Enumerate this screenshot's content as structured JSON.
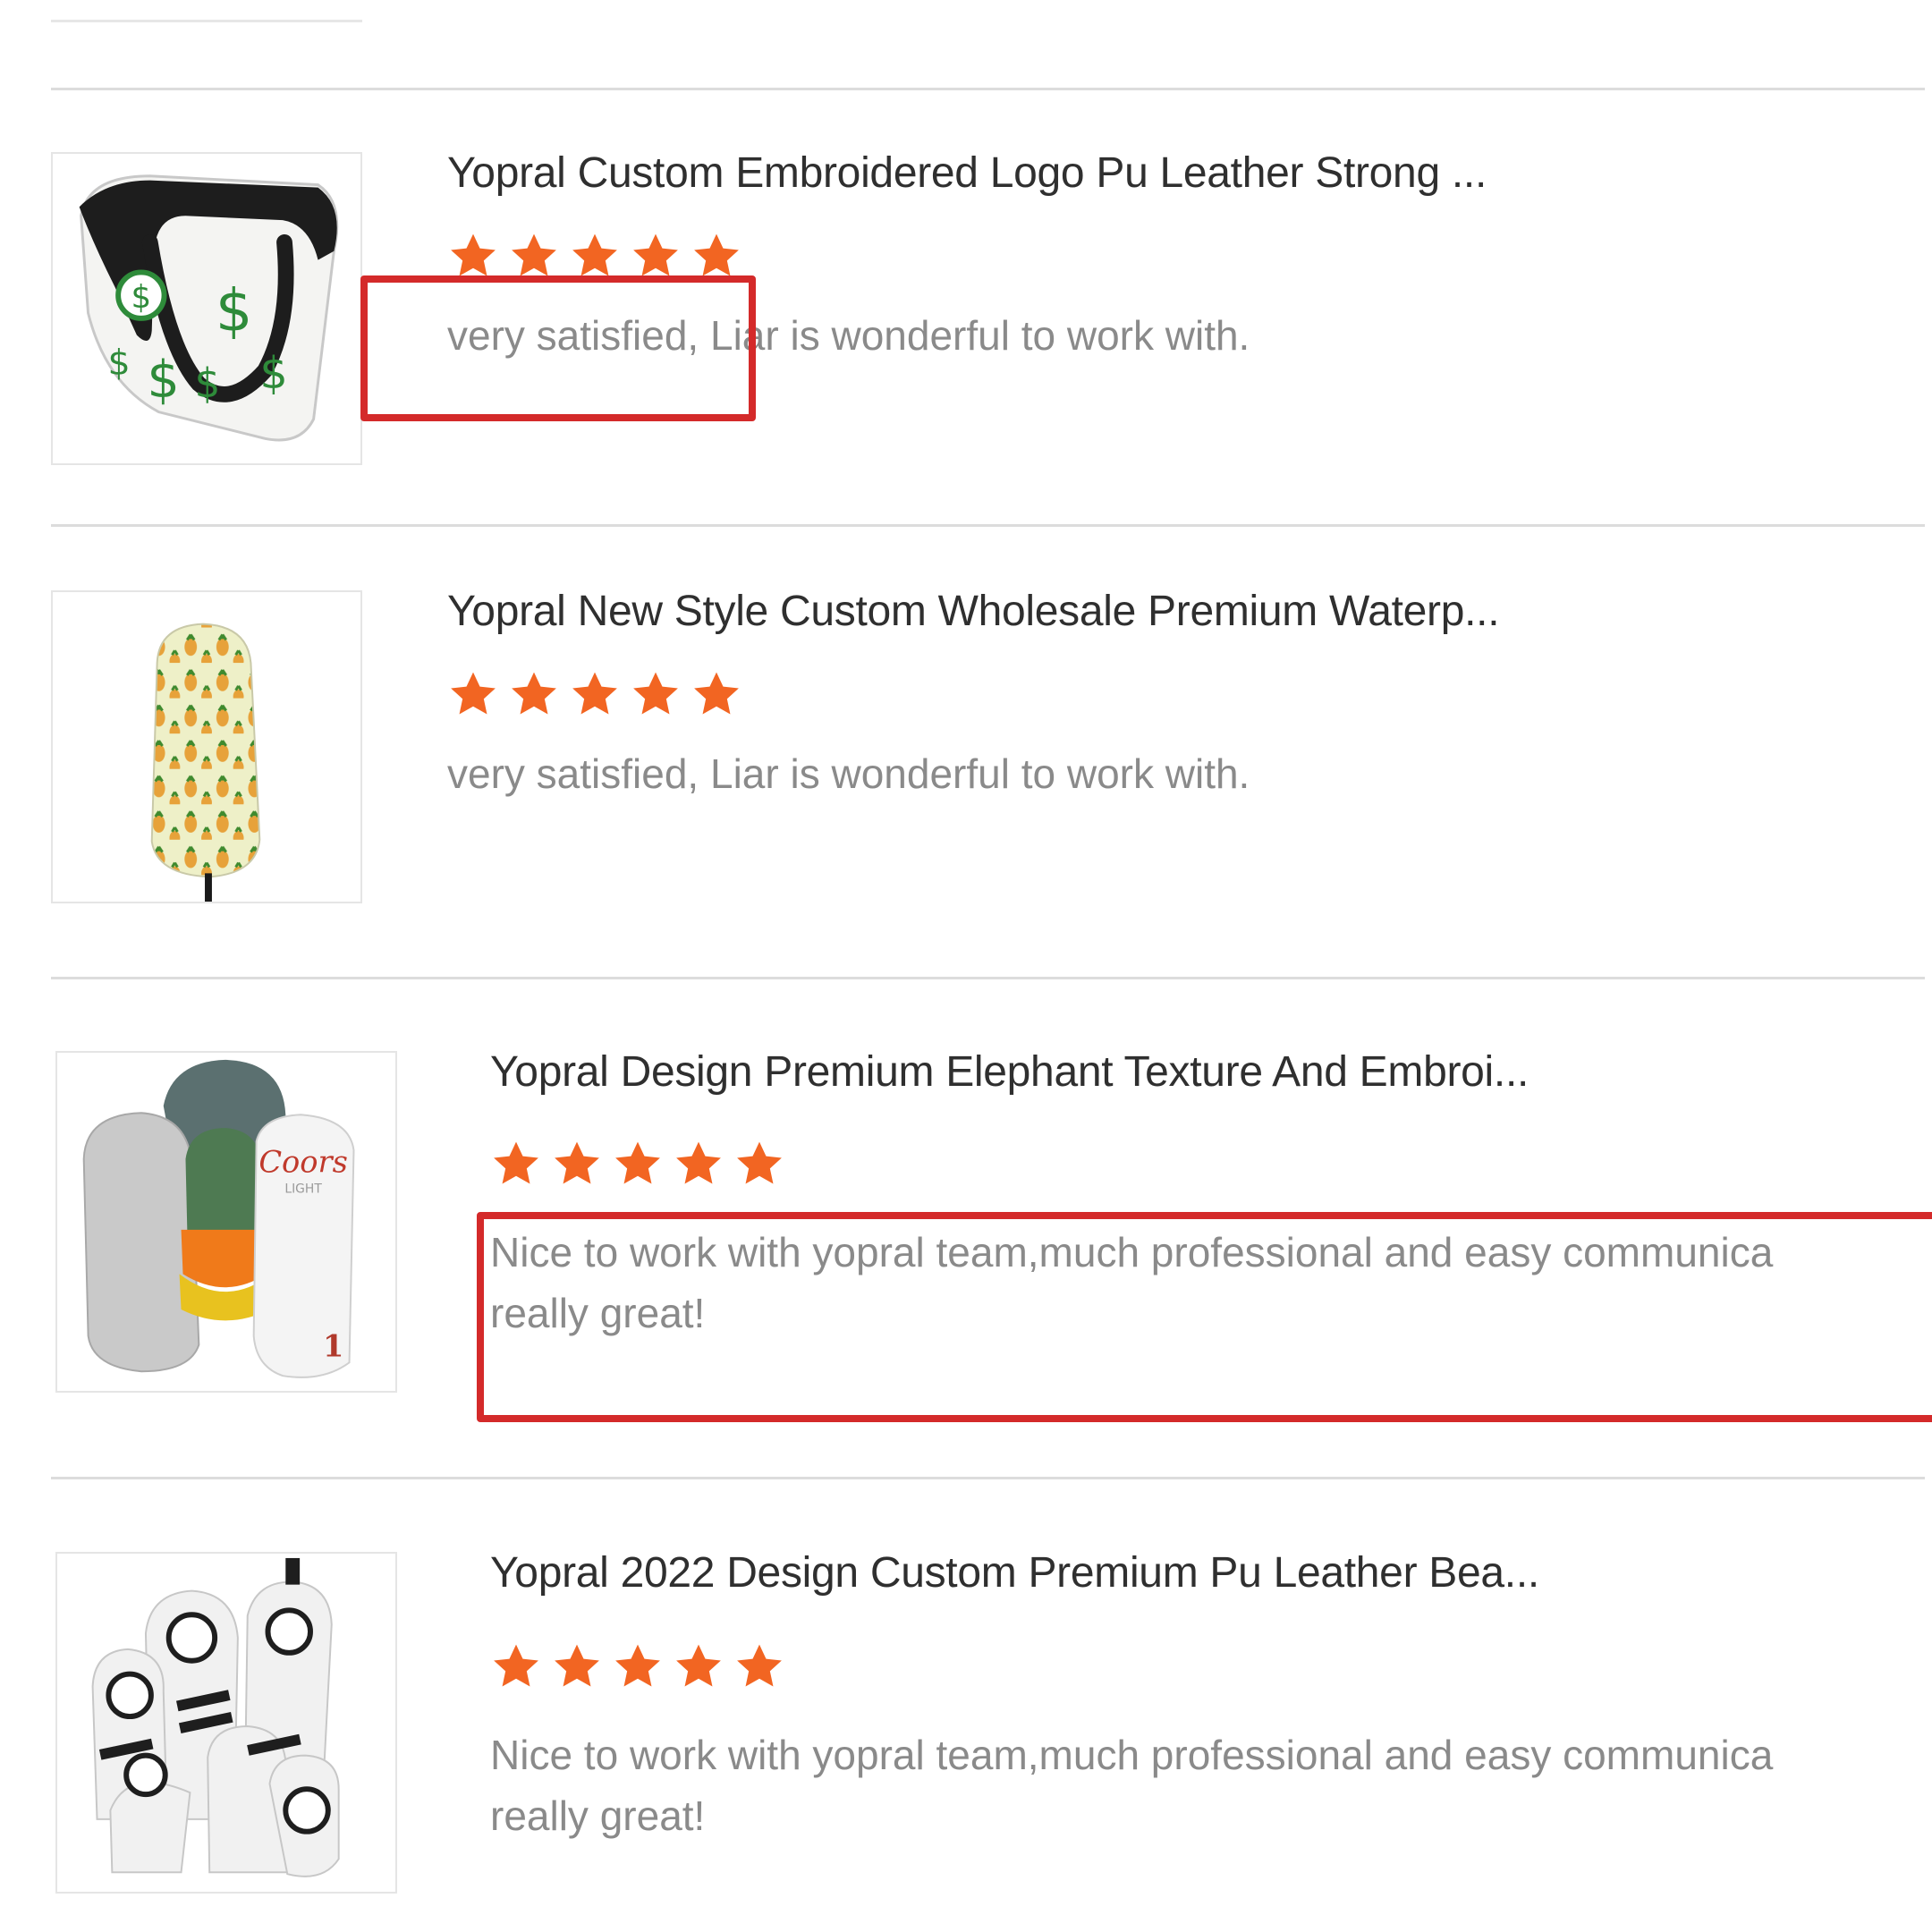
{
  "reviews": [
    {
      "product_title": "Yopral Custom Embroidered Logo Pu Leather Strong ...",
      "rating": 5,
      "comment_line1": "very satisfied, Liar is wonderful to work with.",
      "comment_line2": "",
      "thumb_icon": "dollar-putter-cover-icon"
    },
    {
      "product_title": "Yopral New Style Custom Wholesale Premium Waterp...",
      "rating": 5,
      "comment_line1": "very satisfied, Liar is wonderful to work with.",
      "comment_line2": "",
      "thumb_icon": "pineapple-driver-cover-icon"
    },
    {
      "product_title": "Yopral Design Premium Elephant Texture And Embroi...",
      "rating": 5,
      "comment_line1": "Nice to work with yopral team,much professional and easy communica",
      "comment_line2": "really great!",
      "thumb_icon": "elephant-texture-covers-icon"
    },
    {
      "product_title": "Yopral 2022 Design Custom Premium Pu Leather Bea...",
      "rating": 5,
      "comment_line1": "Nice to work with yopral team,much professional and easy communica",
      "comment_line2": "really great!",
      "thumb_icon": "leather-headcover-set-icon"
    }
  ],
  "colors": {
    "star": "#f26522",
    "highlight_box": "#d42a2a",
    "title_text": "#2f2f2f",
    "comment_text": "#8a8a8a"
  }
}
